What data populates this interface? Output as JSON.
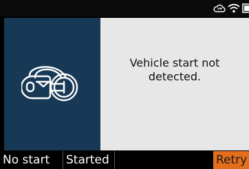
{
  "status": {
    "icons": [
      "cloud-sync-icon",
      "wifi-icon",
      "battery-icon"
    ]
  },
  "illustration": {
    "icon": "vehicle-key-start-icon"
  },
  "message": "Vehicle start not detected.",
  "softkeys": {
    "no_start": "No start",
    "started": "Started",
    "retry": "Retry"
  },
  "colors": {
    "panel_left": "#173955",
    "panel_right": "#e7e7e7",
    "accent": "#e56e1c",
    "background": "#000000"
  }
}
